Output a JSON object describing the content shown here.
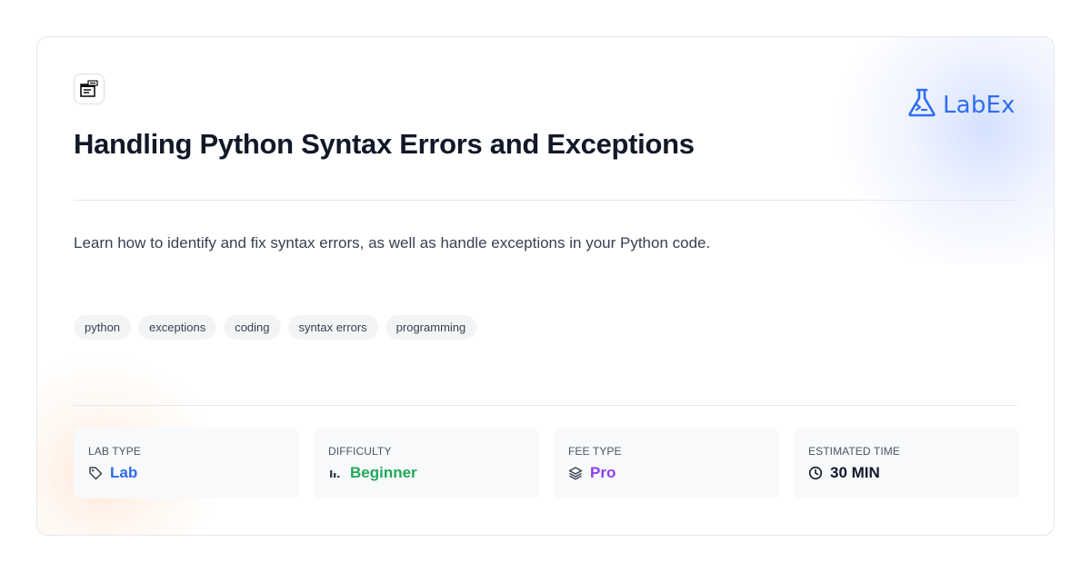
{
  "header": {
    "course_icon": "terminal-window-icon",
    "logo": {
      "text": "LabEx",
      "icon": "flask-terminal-icon",
      "color": "#2f6df0"
    }
  },
  "title": "Handling Python Syntax Errors and Exceptions",
  "description": "Learn how to identify and fix syntax errors, as well as handle exceptions in your Python code.",
  "tags": [
    "python",
    "exceptions",
    "coding",
    "syntax errors",
    "programming"
  ],
  "meta": [
    {
      "label": "LAB TYPE",
      "value": "Lab",
      "icon": "tag-icon",
      "color": "#2f6df0"
    },
    {
      "label": "DIFFICULTY",
      "value": "Beginner",
      "icon": "signal-bars-icon",
      "color": "#22a85a"
    },
    {
      "label": "FEE TYPE",
      "value": "Pro",
      "icon": "layers-icon",
      "color": "#8b3ff0"
    },
    {
      "label": "ESTIMATED TIME",
      "value": "30 MIN",
      "icon": "clock-icon",
      "color": "#111827"
    }
  ]
}
